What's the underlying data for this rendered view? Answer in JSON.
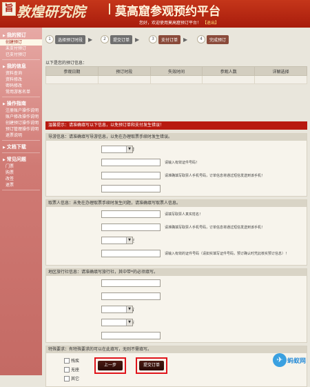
{
  "header": {
    "logo_seal": "旨",
    "logo_text": "敦煌研究院",
    "platform_title": "莫高窟参观预约平台",
    "welcome": "您好，欢迎使用莫高窟预订平台！",
    "logout": "【退出】"
  },
  "sidebar": {
    "groups": [
      {
        "title": "我的预订",
        "items": [
          "创建预订",
          "未支付预订",
          "已支付预订"
        ]
      },
      {
        "title": "我的信息",
        "items": [
          "资料查询",
          "资料修改",
          "密码修改",
          "常用游客名单"
        ]
      },
      {
        "title": "操作指南",
        "items": [
          "注册账户操作说明",
          "账户修改操作说明",
          "创建预订操作说明",
          "预订管理操作说明",
          "退票说明"
        ]
      },
      {
        "title": "文档下载",
        "items": []
      },
      {
        "title": "常见问题",
        "items": [
          "门票",
          "购票",
          "改签",
          "退票"
        ]
      }
    ],
    "active_item": "创建预订"
  },
  "steps": [
    {
      "num": "1",
      "label": "选择预订时段"
    },
    {
      "num": "2",
      "label": "提交订单"
    },
    {
      "num": "3",
      "label": "支付订单"
    },
    {
      "num": "4",
      "label": "完成预订"
    }
  ],
  "orders": {
    "title": "以下是您的预订信息：",
    "columns": [
      "参观日期",
      "预订时段",
      "失效时间",
      "参观人数",
      "详解选择"
    ]
  },
  "notice": "温馨提示：请准确填写以下信息，以免预订单和支付发生错误！",
  "guide": {
    "head": "导游信息：请准确填写导游信息，以免在办理取票手续时发生错误。",
    "fields": [
      {
        "label": "本旅行社常用导游",
        "required": false,
        "type": "select",
        "hint": ""
      },
      {
        "label": "导游证号",
        "required": true,
        "type": "input",
        "hint": "请输入有效证件号码！"
      },
      {
        "label": "导游手机",
        "required": true,
        "type": "input",
        "hint": "请准确填写取票人手机号码，订单信息将通过短信发送到该手机！"
      },
      {
        "label": "导游姓名",
        "required": true,
        "type": "input",
        "hint": ""
      }
    ]
  },
  "ticket": {
    "head": "取票人信息：未免在办理取票手续时发生问题，请准确填写取票人信息。",
    "fields": [
      {
        "label": "取票人姓名",
        "required": true,
        "type": "input",
        "hint": "请填写取票人真实姓名！"
      },
      {
        "label": "取票人手机",
        "required": true,
        "type": "input",
        "hint": "请准确填写取票人手机号码，订单信息将通过短信发送到该手机！"
      },
      {
        "label": "取票人证件类型",
        "required": true,
        "type": "select",
        "hint": ""
      },
      {
        "label": "取票人证件号码",
        "required": true,
        "type": "input",
        "hint": "请输入有效的证件号码（请如实填写证件号码，预订确认时凭此核实预订信息）！"
      }
    ]
  },
  "agency": {
    "head": "地区旅行社信息：请准确填写旅行社，其中带*的必须填写。",
    "fields": [
      {
        "label": "旅行社名称",
        "required": true,
        "type": "input",
        "hint": ""
      },
      {
        "label": "旅行社电话",
        "required": true,
        "type": "input",
        "hint": ""
      },
      {
        "label": "旅行社所在省",
        "required": true,
        "type": "select",
        "hint": ""
      },
      {
        "label": "旅行社所在市",
        "required": false,
        "type": "select",
        "hint": ""
      },
      {
        "label": "客源地",
        "required": true,
        "type": "input",
        "hint": ""
      }
    ]
  },
  "special": {
    "head": "特殊要求：有特殊要求的可以在此填写，无则不需填写。",
    "options": [
      "残疾",
      "无座",
      "其它"
    ]
  },
  "buttons": {
    "prev": "上一步",
    "submit": "提交订单"
  },
  "watermark": {
    "icon": "✈",
    "text": "蚂蚁网"
  }
}
